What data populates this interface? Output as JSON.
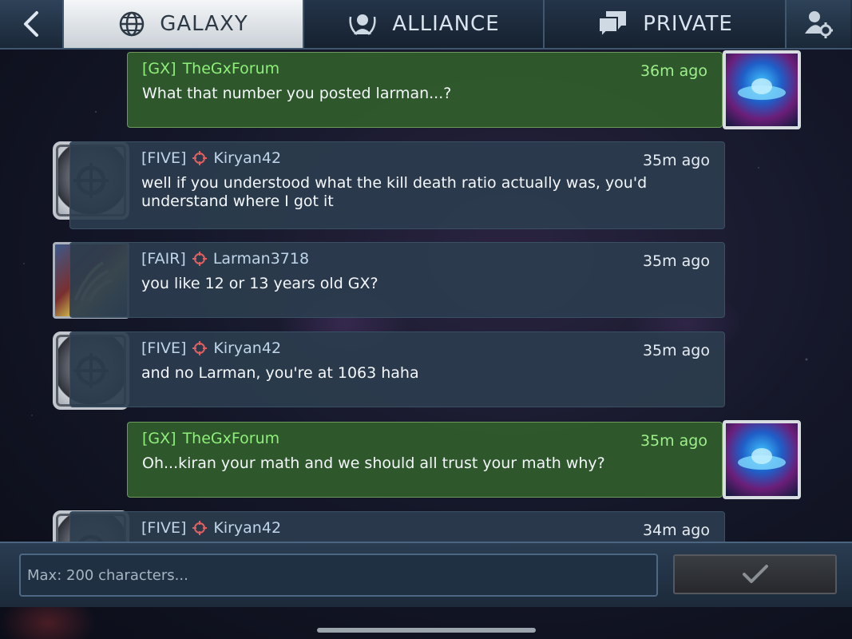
{
  "tabs": [
    {
      "label": "GALAXY",
      "icon": "globe-icon",
      "active": true
    },
    {
      "label": "ALLIANCE",
      "icon": "alliance-emblem-icon",
      "active": false
    },
    {
      "label": "PRIVATE",
      "icon": "chat-bubbles-icon",
      "active": false
    }
  ],
  "messages": [
    {
      "tag": "[GX]",
      "name": "TheGxForum",
      "time": "36m ago",
      "text": "What that number you posted larman...?",
      "self": true,
      "avatar": "gx"
    },
    {
      "tag": "[FIVE]",
      "name": "Kiryan42",
      "time": "35m ago",
      "text": "well if you understood what the kill death ratio actually was, you'd understand where I got it",
      "self": false,
      "avatar": "five"
    },
    {
      "tag": "[FAIR]",
      "name": "Larman3718",
      "time": "35m ago",
      "text": "you like 12 or 13 years old GX?",
      "self": false,
      "avatar": "fair"
    },
    {
      "tag": "[FIVE]",
      "name": "Kiryan42",
      "time": "35m ago",
      "text": "and no Larman, you're at 1063 haha",
      "self": false,
      "avatar": "five"
    },
    {
      "tag": "[GX]",
      "name": "TheGxForum",
      "time": "35m ago",
      "text": "Oh...kiran your math and we should all trust your math why?",
      "self": true,
      "avatar": "gx"
    },
    {
      "tag": "[FIVE]",
      "name": "Kiryan42",
      "time": "34m ago",
      "text": "",
      "self": false,
      "avatar": "five"
    }
  ],
  "input": {
    "placeholder": "Max: 200 characters...",
    "value": ""
  },
  "colors": {
    "self_bubble": "#305c2c",
    "other_bubble": "#2b3d4e",
    "self_name": "#8ef07a",
    "target_icon": "#e06060",
    "active_tab": "#e4e8ec"
  }
}
